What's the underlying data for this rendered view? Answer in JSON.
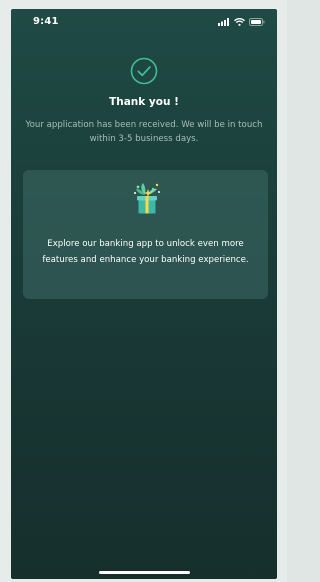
{
  "status_bar": {
    "time": "9:41",
    "icons": [
      "signal-icon",
      "wifi-icon",
      "battery-icon"
    ]
  },
  "confirmation": {
    "icon": "check-circle-icon",
    "title": "Thank you !",
    "message": "Your application has been received. We will be in touch within 3-5 business days."
  },
  "promo_card": {
    "icon": "gift-box-icon",
    "text": "Explore our banking app to unlock even more features and enhance your banking experience."
  },
  "colors": {
    "background_top": "#1f4a45",
    "background_bottom": "#162f2d",
    "accent": "#3fbf95",
    "card_background": "#2e524d",
    "secondary_text": "#a9bebb"
  }
}
